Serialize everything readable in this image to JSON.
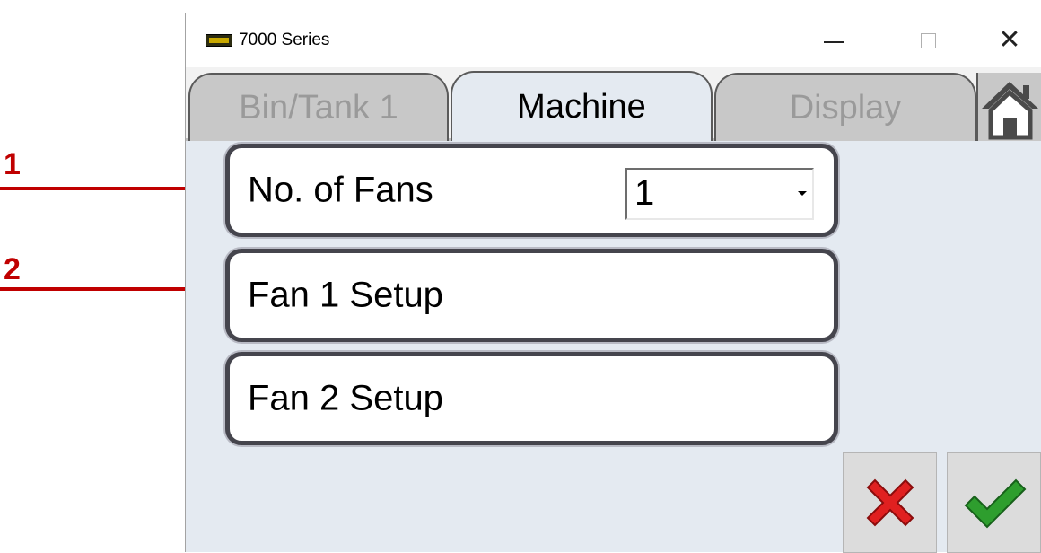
{
  "annotations": [
    "1",
    "2"
  ],
  "window": {
    "title": "7000 Series"
  },
  "tabs": [
    {
      "label": "Bin/Tank 1",
      "active": false
    },
    {
      "label": "Machine",
      "active": true
    },
    {
      "label": "Display",
      "active": false
    }
  ],
  "rows": {
    "fans_label": "No. of Fans",
    "fans_value": "1",
    "fan1_label": "Fan 1 Setup",
    "fan2_label": "Fan 2 Setup"
  },
  "colors": {
    "annotation": "#c00000",
    "cancel": "#e02020",
    "confirm": "#2e9e2e",
    "content_bg": "#e4eaf1"
  },
  "icons": [
    "app-icon",
    "minimize-icon",
    "maximize-icon",
    "close-icon",
    "home-icon",
    "cancel-icon",
    "checkmark-icon"
  ]
}
